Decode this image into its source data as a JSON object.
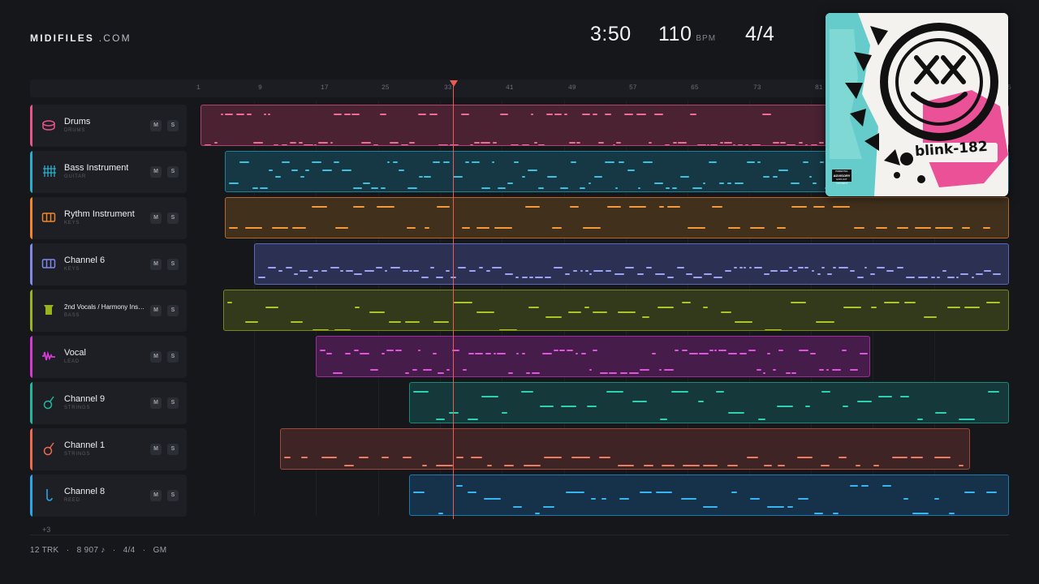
{
  "brand": {
    "name": "MIDIFILES",
    "suffix": ".COM"
  },
  "stats": {
    "duration": "3:50",
    "tempo": "110",
    "tempo_unit": "BPM",
    "time_signature": "4/4"
  },
  "ruler": {
    "ticks": [
      "1",
      "9",
      "17",
      "25",
      "33",
      "41",
      "49",
      "57",
      "65",
      "73",
      "81",
      "5"
    ]
  },
  "tracks": [
    {
      "name": "Drums",
      "sub": "DRUMS",
      "color": "#e8558c",
      "icon": "drum-icon"
    },
    {
      "name": "Bass Instrument",
      "sub": "GUITAR",
      "color": "#2aaecb",
      "icon": "guitar-grid-icon"
    },
    {
      "name": "Rythm Instrument",
      "sub": "KEYS",
      "color": "#f0852a",
      "icon": "keys-icon"
    },
    {
      "name": "Channel 6",
      "sub": "KEYS",
      "color": "#7e89ea",
      "icon": "keys-icon"
    },
    {
      "name": "2nd Vocals / Harmony Ins…",
      "sub": "BASS",
      "color": "#98b31e",
      "icon": "bass-icon"
    },
    {
      "name": "Vocal",
      "sub": "LEAD",
      "color": "#d43bd2",
      "icon": "waveform-icon"
    },
    {
      "name": "Channel 9",
      "sub": "STRINGS",
      "color": "#1fb89e",
      "icon": "acoustic-guitar-icon"
    },
    {
      "name": "Channel 1",
      "sub": "STRINGS",
      "color": "#ef6a4f",
      "icon": "acoustic-guitar-icon"
    },
    {
      "name": "Channel 8",
      "sub": "REED",
      "color": "#28a6e8",
      "icon": "reed-icon"
    }
  ],
  "buttons": {
    "mute": "M",
    "solo": "S"
  },
  "more_tracks": "+3",
  "footer": {
    "tracks": "12 TRK",
    "notes": "8 907 ♪",
    "sig": "4/4",
    "standard": "GM",
    "sep": "·"
  },
  "cover": {
    "band": "blink-182",
    "advisory_top": "PARENTAL",
    "advisory_main": "ADVISORY",
    "advisory_bottom": "EXPLICIT CONTENT"
  },
  "colors": {
    "background": "#16171b",
    "playhead": "#ee5a55"
  }
}
